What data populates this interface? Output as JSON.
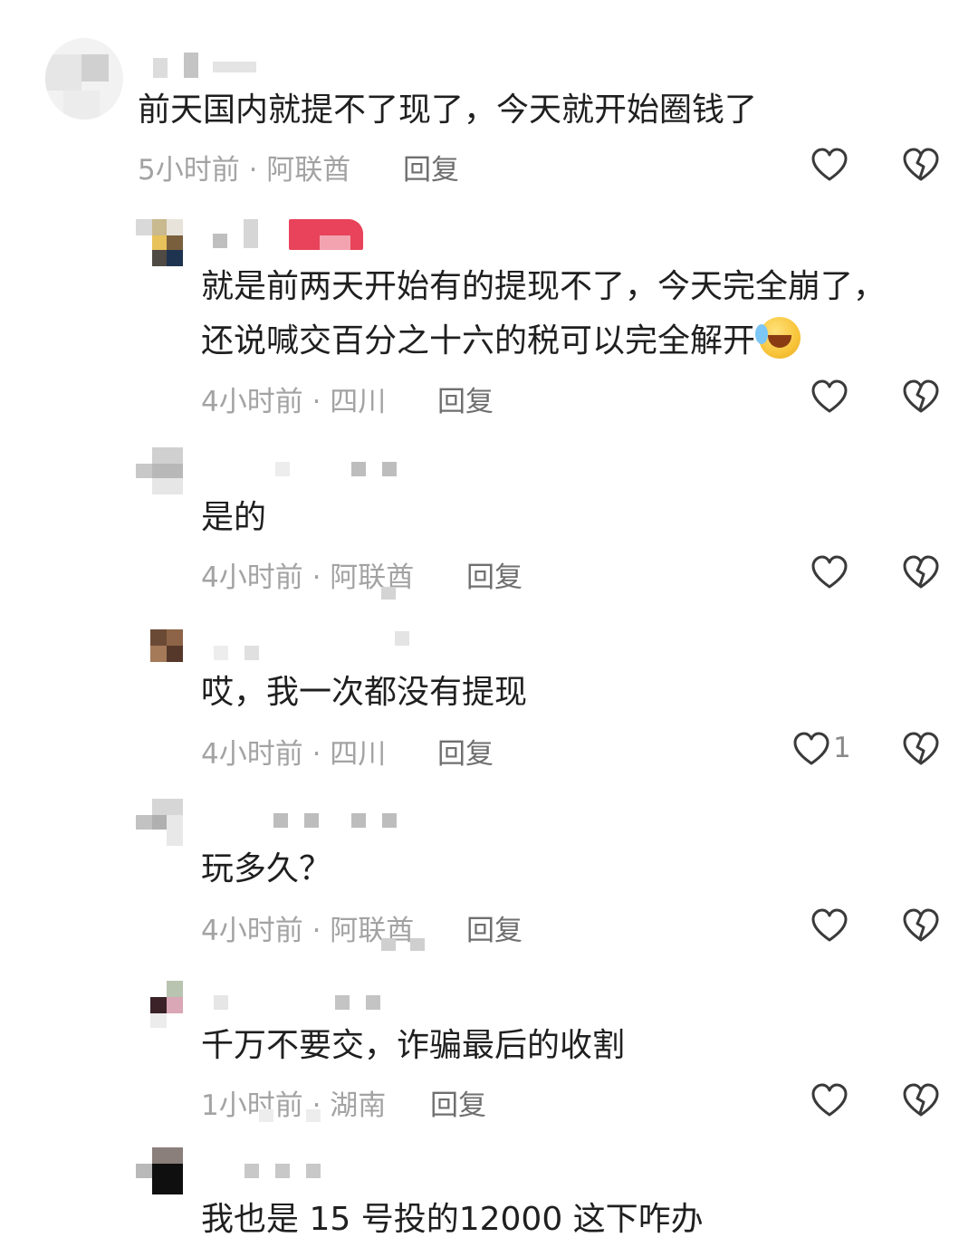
{
  "comments": [
    {
      "text_lines": [
        "前天国内就提不了现了，今天就开始圈钱了"
      ],
      "time": "5小时前",
      "location": "阿联酋",
      "reply": "回复",
      "likes": ""
    },
    {
      "text_lines": [
        "就是前两天开始有的提现不了，今天完全崩了，",
        "还说喊交百分之十六的税可以完全解开"
      ],
      "emoji": "laughing-crying",
      "time": "4小时前",
      "location": "四川",
      "reply": "回复",
      "likes": ""
    },
    {
      "text_lines": [
        "是的"
      ],
      "time": "4小时前",
      "location": "阿联酋",
      "reply": "回复",
      "likes": ""
    },
    {
      "text_lines": [
        "哎，我一次都没有提现"
      ],
      "time": "4小时前",
      "location": "四川",
      "reply": "回复",
      "likes": "1"
    },
    {
      "text_lines": [
        "玩多久？"
      ],
      "time": "4小时前",
      "location": "阿联酋",
      "reply": "回复",
      "likes": ""
    },
    {
      "text_lines": [
        "千万不要交，诈骗最后的收割"
      ],
      "time": "1小时前",
      "location": "湖南",
      "reply": "回复",
      "likes": ""
    },
    {
      "text_lines": [
        "我也是 15 号投的12000 这下咋办"
      ]
    }
  ],
  "separator": " · ",
  "icons": {
    "like": "heart-outline-icon",
    "dislike": "broken-heart-icon"
  },
  "colors": {
    "text": "#1f1f1f",
    "meta": "#a3a3a3",
    "reply": "#6f6f6f",
    "icon": "#3a3a3a",
    "badge": "#e8435a"
  }
}
